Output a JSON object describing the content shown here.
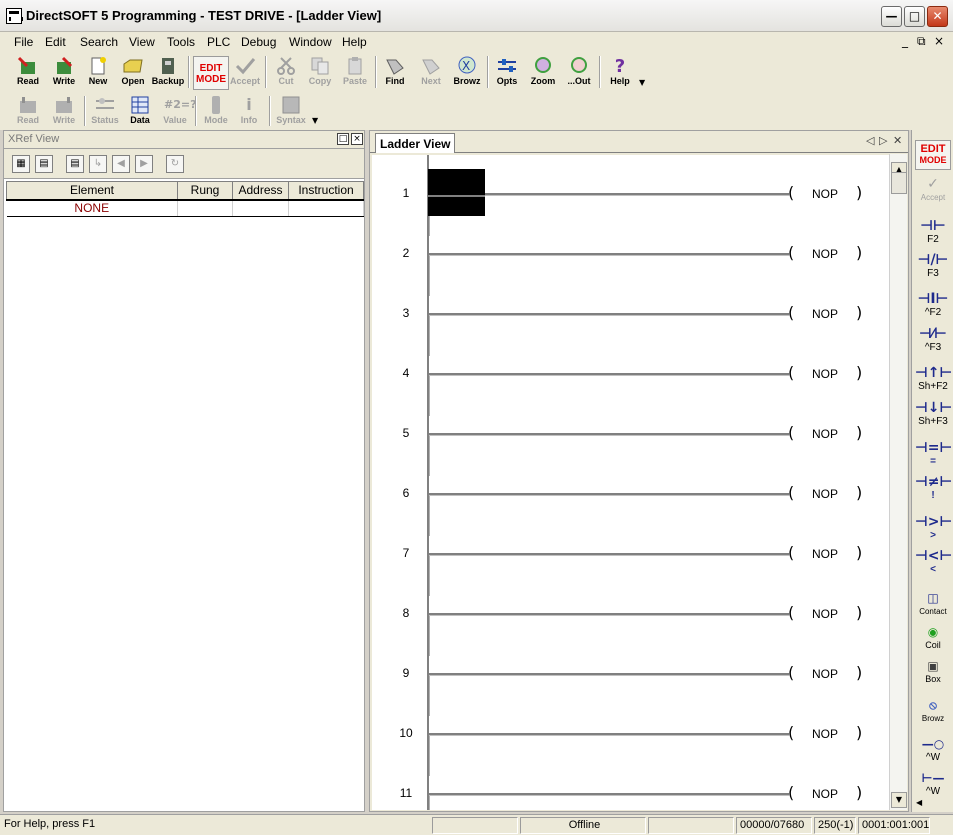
{
  "window": {
    "title": "DirectSOFT 5 Programming - TEST DRIVE - [Ladder View]"
  },
  "menu": {
    "items": [
      "File",
      "Edit",
      "Search",
      "View",
      "Tools",
      "PLC",
      "Debug",
      "Window",
      "Help"
    ]
  },
  "toolbar1": {
    "read": "Read",
    "write": "Write",
    "new": "New",
    "open": "Open",
    "backup": "Backup",
    "edit_mode_line1": "EDIT",
    "edit_mode_line2": "MODE",
    "accept": "Accept",
    "cut": "Cut",
    "copy": "Copy",
    "paste": "Paste",
    "find": "Find",
    "next": "Next",
    "browz": "Browz",
    "opts": "Opts",
    "zoom": "Zoom",
    "zoomout": "...Out",
    "help": "Help"
  },
  "toolbar2": {
    "read": "Read",
    "write": "Write",
    "status": "Status",
    "data": "Data",
    "value": "Value",
    "mode": "Mode",
    "info": "Info",
    "syntax": "Syntax"
  },
  "xref": {
    "title": "XRef View",
    "columns": [
      "Element",
      "Rung",
      "Address",
      "Instruction"
    ],
    "rows": [
      {
        "element": "NONE",
        "rung": "",
        "address": "",
        "instruction": ""
      }
    ]
  },
  "ladder": {
    "tab": "Ladder View",
    "coil": "NOP",
    "rungs": [
      "1",
      "2",
      "3",
      "4",
      "5",
      "6",
      "7",
      "8",
      "9",
      "10",
      "11"
    ]
  },
  "right_toolbar": {
    "edit1": "EDIT",
    "edit2": "MODE",
    "accept": "Accept",
    "f2": "F2",
    "f3": "F3",
    "cf2": "^F2",
    "cf3": "^F3",
    "sf2": "Sh+F2",
    "sf3": "Sh+F3",
    "eq": "=",
    "ne": "!",
    "gt": ">",
    "lt": "<",
    "contact": "Contact",
    "coil": "Coil",
    "box": "Box",
    "browz": "Browz",
    "w1": "^W",
    "w2": "^W"
  },
  "status": {
    "help": "For Help, press F1",
    "mode": "Offline",
    "memory": "00000/07680",
    "rung": "250(-1)",
    "position": "0001:001:001"
  },
  "colors": {
    "accent_red": "#e00000",
    "ladder_blue": "#1e2a8c",
    "none_text": "#8b0000"
  }
}
